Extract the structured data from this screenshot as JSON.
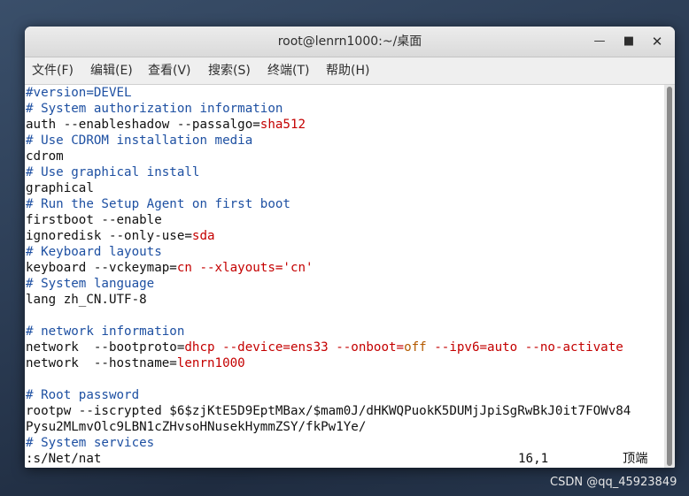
{
  "window": {
    "title": "root@lenrn1000:~/桌面",
    "minimize_icon": "minimize-icon",
    "maximize_icon": "maximize-icon",
    "close_icon": "close-icon",
    "minimize_glyph": "—",
    "maximize_glyph": "■",
    "close_glyph": "✕"
  },
  "menu": {
    "file": "文件(F)",
    "edit": "编辑(E)",
    "view": "查看(V)",
    "search": "搜索(S)",
    "terminal": "终端(T)",
    "help": "帮助(H)"
  },
  "terminal": {
    "lines": [
      {
        "text": "#version=DEVEL",
        "type": "comment"
      },
      {
        "text": "# System authorization information",
        "type": "comment"
      },
      {
        "a": "auth --enableshadow --passalgo=",
        "b": "sha512"
      },
      {
        "text": "# Use CDROM installation media",
        "type": "comment"
      },
      {
        "text": "cdrom",
        "type": "plain"
      },
      {
        "text": "# Use graphical install",
        "type": "comment"
      },
      {
        "text": "graphical",
        "type": "plain"
      },
      {
        "text": "# Run the Setup Agent on first boot",
        "type": "comment"
      },
      {
        "text": "firstboot --enable",
        "type": "plain"
      },
      {
        "a": "ignoredisk --only-use=",
        "b": "sda"
      },
      {
        "text": "# Keyboard layouts",
        "type": "comment"
      },
      {
        "a": "keyboard --vckeymap=",
        "b": "cn --xlayouts='cn'"
      },
      {
        "text": "# System language",
        "type": "comment"
      },
      {
        "text": "lang zh_CN.UTF-8",
        "type": "plain"
      },
      {
        "text": "",
        "type": "plain"
      },
      {
        "text": "# network information",
        "type": "comment"
      },
      {
        "network1": {
          "p1": "network  --bootproto=",
          "v1": "dhcp --device=ens33 --onboot=",
          "v2": "off",
          "v3": " --ipv6=auto --no-activate"
        }
      },
      {
        "a": "network  --hostname=",
        "b": "lenrn1000"
      },
      {
        "text": "",
        "type": "plain"
      },
      {
        "text": "# Root password",
        "type": "comment"
      },
      {
        "text": "rootpw --iscrypted $6$zjKtE5D9EptMBax/$mam0J/dHKWQPuokK5DUMjJpiSgRwBkJ0it7FOWv84",
        "type": "plain"
      },
      {
        "text": "Pysu2MLmvOlc9LBN1cZHvsoHNusekHymmZSY/fkPw1Ye/",
        "type": "plain"
      },
      {
        "text": "# System services",
        "type": "comment"
      }
    ],
    "status_command": ":s/Net/nat",
    "status_position": "16,1",
    "status_scroll": "顶端"
  },
  "watermark": "CSDN @qq_45923849"
}
